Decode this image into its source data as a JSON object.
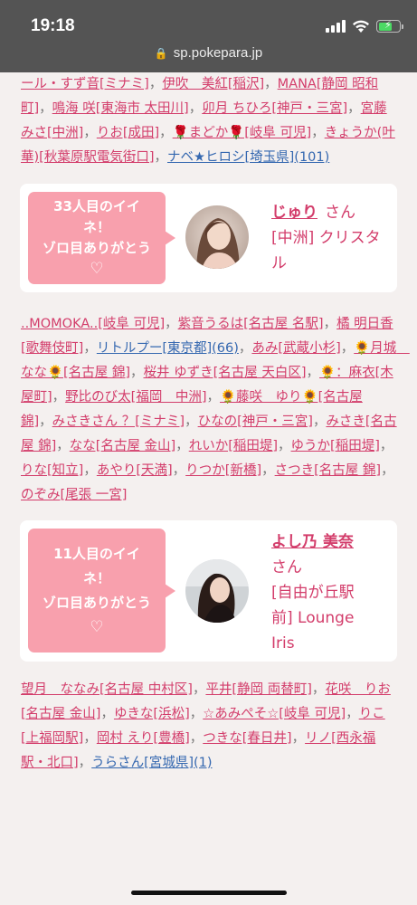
{
  "status": {
    "time": "19:18",
    "url": "sp.pokepara.jp",
    "battery_level": 0.7,
    "battery_color": "#4cd964"
  },
  "list1": [
    {
      "text": "ール・すず音[ミナミ]",
      "color": "pink"
    },
    {
      "text": "伊吹　美紅[稲沢]",
      "color": "pink"
    },
    {
      "text": "MANA[静岡 昭和町]",
      "color": "pink"
    },
    {
      "text": "鳴海 咲[東海市 太田川]",
      "color": "pink"
    },
    {
      "text": "卯月 ちひろ[神戸・三宮]",
      "color": "pink"
    },
    {
      "text": "宮藤 みさ[中洲]",
      "color": "pink"
    },
    {
      "text": "りお[成田]",
      "color": "pink"
    },
    {
      "text": "🌹まどか🌹[岐阜 可児]",
      "color": "pink"
    },
    {
      "text": "きょうか(叶華)[秋葉原駅電気街口]",
      "color": "pink"
    },
    {
      "text": "ナベ★ヒロシ[埼玉県](101)",
      "color": "blue"
    }
  ],
  "card1": {
    "bubble_line1": "33人目のイイ",
    "bubble_line2": "ネ！",
    "bubble_line3": "ゾロ目ありがとう",
    "heart": "♡",
    "name": "じゅり",
    "san": "さん",
    "shop_line1": "[中洲] クリスタ",
    "shop_line2": "ル"
  },
  "list2": [
    {
      "text": "..MOMOKA..[岐阜 可児]",
      "color": "pink"
    },
    {
      "text": "紫音うるは[名古屋 名駅]",
      "color": "pink"
    },
    {
      "text": "橘 明日香[歌舞伎町]",
      "color": "pink"
    },
    {
      "text": "リトルプー[東京都](66)",
      "color": "blue"
    },
    {
      "text": "あみ[武蔵小杉]",
      "color": "pink"
    },
    {
      "text": "🌻月城　なな🌻[名古屋 錦]",
      "color": "pink"
    },
    {
      "text": "桜井 ゆずき[名古屋 天白区]",
      "color": "pink"
    },
    {
      "text": "🌻：麻衣[木屋町]",
      "color": "pink"
    },
    {
      "text": "野比のび太[福岡　中洲]",
      "color": "pink"
    },
    {
      "text": "🌻藤咲　ゆり🌻[名古屋 錦]",
      "color": "pink"
    },
    {
      "text": "みさきさん ？[ミナミ]",
      "color": "pink"
    },
    {
      "text": "ひなの[神戸・三宮]",
      "color": "pink"
    },
    {
      "text": "みさき[名古屋 錦]",
      "color": "pink"
    },
    {
      "text": "なな[名古屋 金山]",
      "color": "pink"
    },
    {
      "text": "れいか[稲田堤]",
      "color": "pink"
    },
    {
      "text": "ゆうか[稲田堤]",
      "color": "pink"
    },
    {
      "text": "りな[知立]",
      "color": "pink"
    },
    {
      "text": "あやり[天満]",
      "color": "pink"
    },
    {
      "text": "りつか[新橋]",
      "color": "pink"
    },
    {
      "text": "さつき[名古屋 錦]",
      "color": "pink"
    },
    {
      "text": "のぞみ[尾張 一宮]",
      "color": "pink"
    }
  ],
  "card2": {
    "bubble_line1": "11人目のイイ",
    "bubble_line2": "ネ！",
    "bubble_line3": "ゾロ目ありがとう",
    "heart": "♡",
    "name": "よし乃 美奈",
    "san": "さん",
    "shop_line1": "[自由が丘駅",
    "shop_line2": "前] Lounge",
    "shop_line3": "Iris"
  },
  "list3": [
    {
      "text": "望月　ななみ[名古屋 中村区]",
      "color": "pink"
    },
    {
      "text": "平井[静岡 両替町]",
      "color": "pink"
    },
    {
      "text": "花咲　りお[名古屋 金山]",
      "color": "pink"
    },
    {
      "text": "ゆきな[浜松]",
      "color": "pink"
    },
    {
      "text": "☆あみぺそ☆[岐阜 可児]",
      "color": "pink"
    },
    {
      "text": "りこ[上福岡駅]",
      "color": "pink"
    },
    {
      "text": "岡村 えり[豊橋]",
      "color": "pink"
    },
    {
      "text": "つきな[春日井]",
      "color": "pink"
    },
    {
      "text": "リノ[西永福駅・北口]",
      "color": "pink"
    },
    {
      "text": "うらさん[宮城県](1)",
      "color": "blue"
    }
  ],
  "separator": "，"
}
